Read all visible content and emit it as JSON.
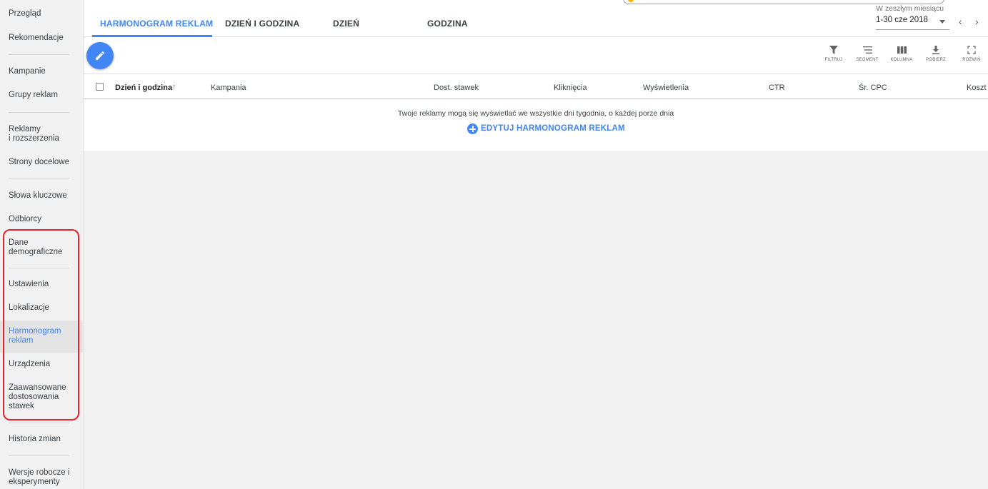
{
  "sidebar": {
    "items": [
      {
        "label": "Przegląd"
      },
      {
        "label": "Rekomendacje"
      },
      {
        "label": "Kampanie"
      },
      {
        "label": "Grupy reklam"
      },
      {
        "label": "Reklamy\ni rozszerzenia"
      },
      {
        "label": "Strony docelowe"
      },
      {
        "label": "Słowa kluczowe"
      },
      {
        "label": "Odbiorcy"
      },
      {
        "label": "Dane\ndemograficzne"
      },
      {
        "label": "Ustawienia"
      },
      {
        "label": "Lokalizacje"
      },
      {
        "label": "Harmonogram\nreklam",
        "active": true
      },
      {
        "label": "Urządzenia"
      },
      {
        "label": "Zaawansowane\ndostosowania\nstawek"
      },
      {
        "label": "Historia zmian"
      },
      {
        "label": "Wersje robocze i\neksperymenty"
      }
    ]
  },
  "tabs": [
    {
      "label": "HARMONOGRAM REKLAM",
      "active": true
    },
    {
      "label": "DZIEŃ I GODZINA"
    },
    {
      "label": "DZIEŃ"
    },
    {
      "label": "GODZINA"
    }
  ],
  "date_range": {
    "caption": "W zeszłym miesiącu",
    "value": "1-30 cze 2018",
    "prev_icon": "chevron-left-icon",
    "next_icon": "chevron-right-icon"
  },
  "toolbar": {
    "fab_icon": "pencil-icon",
    "tools": [
      {
        "label": "FILTRUJ",
        "icon": "filter-icon"
      },
      {
        "label": "SEGMENT",
        "icon": "segment-icon"
      },
      {
        "label": "KOLUMNA",
        "icon": "columns-icon"
      },
      {
        "label": "POBIERZ",
        "icon": "download-icon"
      },
      {
        "label": "ROZWIŃ",
        "icon": "fullscreen-icon"
      }
    ]
  },
  "table": {
    "columns": [
      {
        "label": "Dzień i godzina",
        "sort": "ascending"
      },
      {
        "label": "Kampania"
      },
      {
        "label": "Dost. stawek"
      },
      {
        "label": "Kliknięcia"
      },
      {
        "label": "Wyświetlenia"
      },
      {
        "label": "CTR"
      },
      {
        "label": "Śr. CPC"
      },
      {
        "label": "Koszt"
      }
    ],
    "sort_arrow": "↑",
    "empty_message": "Twoje reklamy mogą się wyświetlać we wszystkie dni tygodnia, o każdej porze dnia",
    "edit_action": "EDYTUJ HARMONOGRAM REKLAM"
  },
  "colors": {
    "accent": "#4285f4",
    "highlight": "#e8212d",
    "sidebar_bg": "#f1f1f1"
  }
}
